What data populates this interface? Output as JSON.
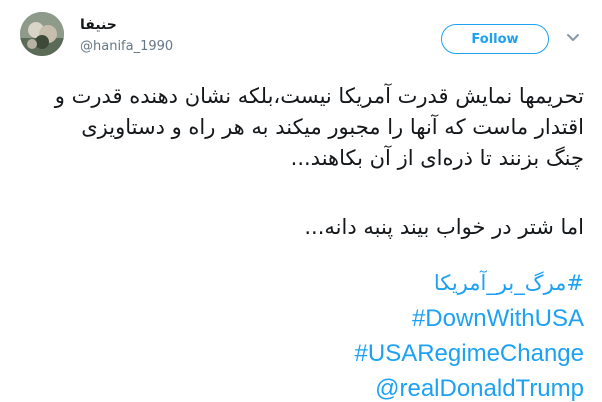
{
  "tweet": {
    "author": {
      "display_name": "حنيفا",
      "handle": "@hanifa_1990",
      "avatar_icon": "avatar-photo-icon"
    },
    "follow_label": "Follow",
    "menu_icon": "chevron-down-icon",
    "paragraph1": [
      "تحریمها نمایش قدرت آمریکا نیست،بلکه نشان دهنده قدرت و",
      "اقتدار ماست که آنها را مجبور میکند به هر راه و دستاویزی",
      "چنگ بزنند تا ذره‌ای از آن بکاهند..."
    ],
    "paragraph2": "اما شتر در خواب بیند پنبه دانه...",
    "hashtags": [
      "#مرگ_بر_آمریکا",
      "#DownWithUSA",
      "#USARegimeChange",
      "@realDonaldTrump"
    ]
  },
  "colors": {
    "text": "#14171a",
    "secondary": "#657786",
    "accent": "#1da1f2"
  }
}
